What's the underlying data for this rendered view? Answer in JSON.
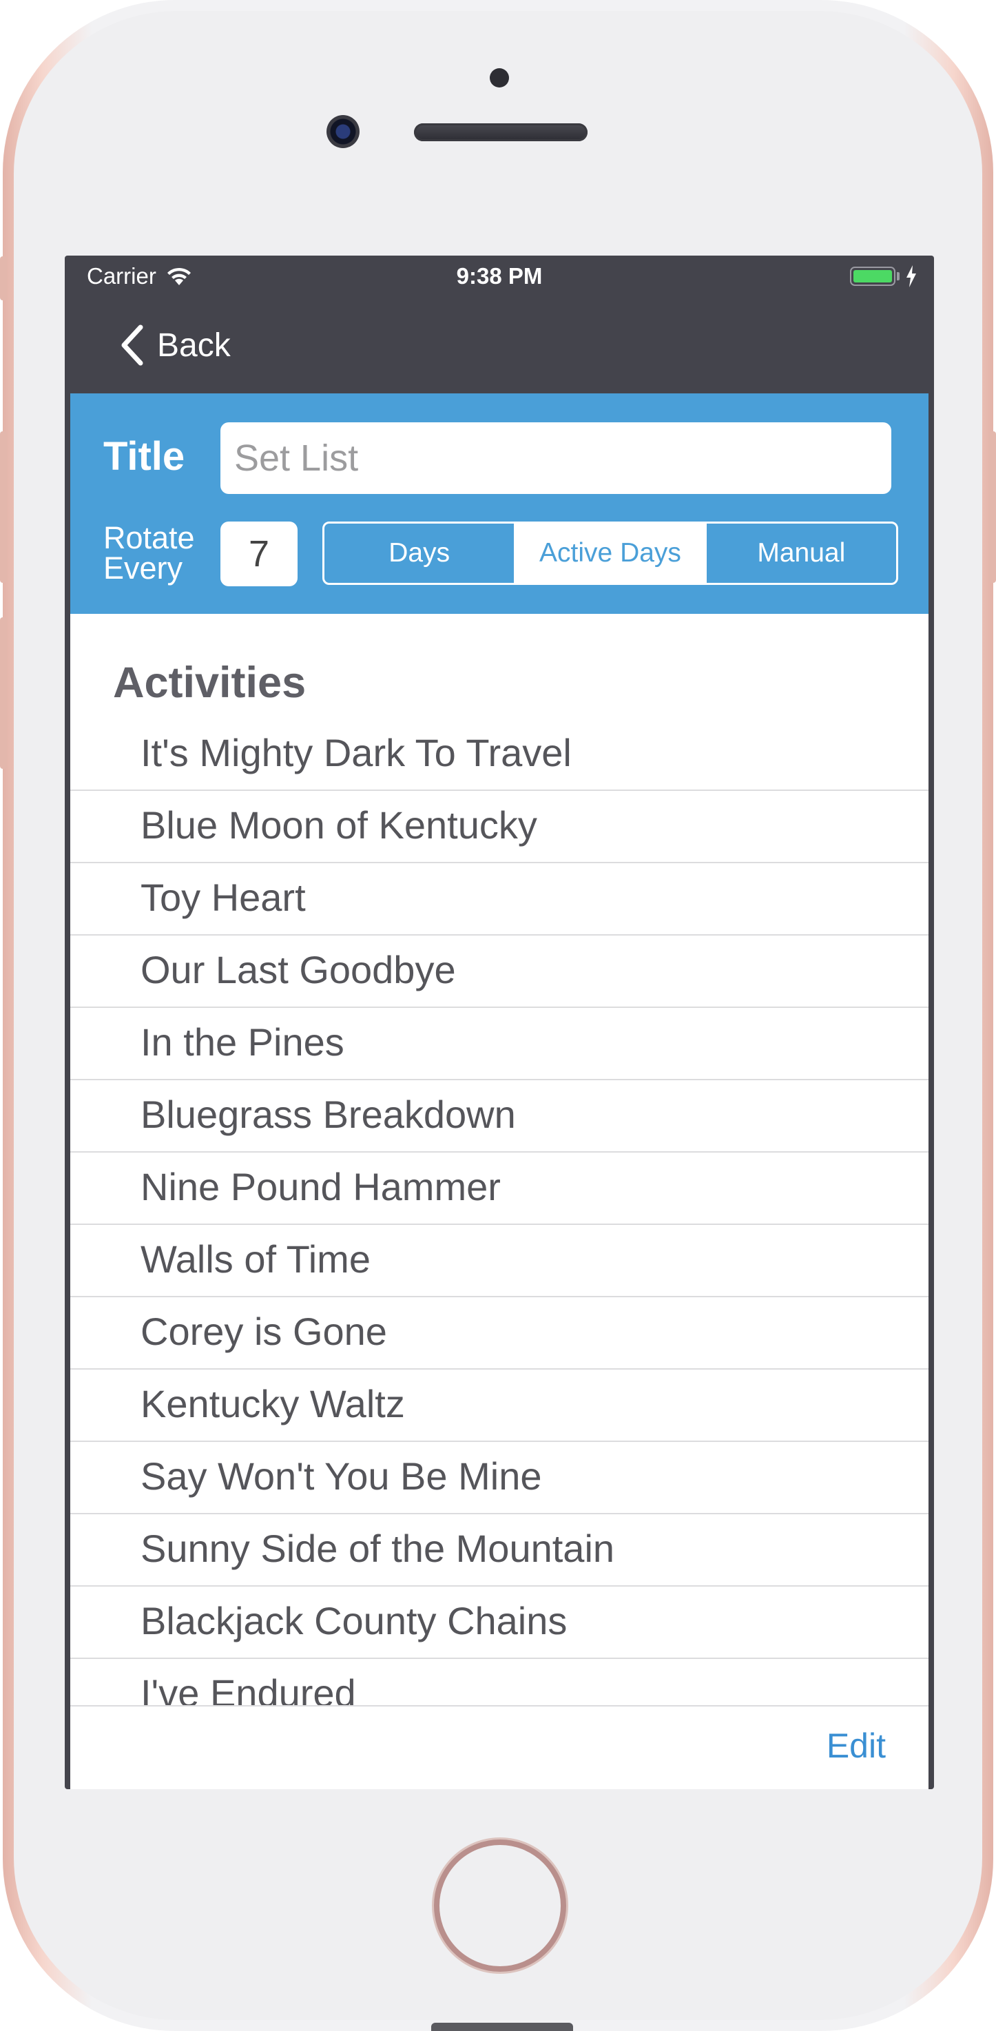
{
  "status_bar": {
    "carrier": "Carrier",
    "time": "9:38 PM",
    "battery_color": "#4cd964"
  },
  "nav": {
    "back_label": "Back",
    "back_icon": "chevron-left-icon"
  },
  "header": {
    "title_label": "Title",
    "title_placeholder": "Set List",
    "rotate_label_line1": "Rotate",
    "rotate_label_line2": "Every",
    "rotate_value": "7",
    "segments": [
      "Days",
      "Active Days",
      "Manual"
    ],
    "selected_segment": "Active Days",
    "accent_color": "#4a9fd8"
  },
  "activities": {
    "section_title": "Activities",
    "items": [
      "It's Mighty Dark To Travel",
      "Blue Moon of Kentucky",
      "Toy Heart",
      "Our Last Goodbye",
      "In the Pines",
      "Bluegrass Breakdown",
      "Nine Pound Hammer",
      "Walls of Time",
      "Corey is Gone",
      "Kentucky Waltz",
      "Say Won't You Be Mine",
      "Sunny Side of the Mountain",
      "Blackjack County Chains",
      "I've Endured"
    ]
  },
  "toolbar": {
    "edit_label": "Edit"
  }
}
